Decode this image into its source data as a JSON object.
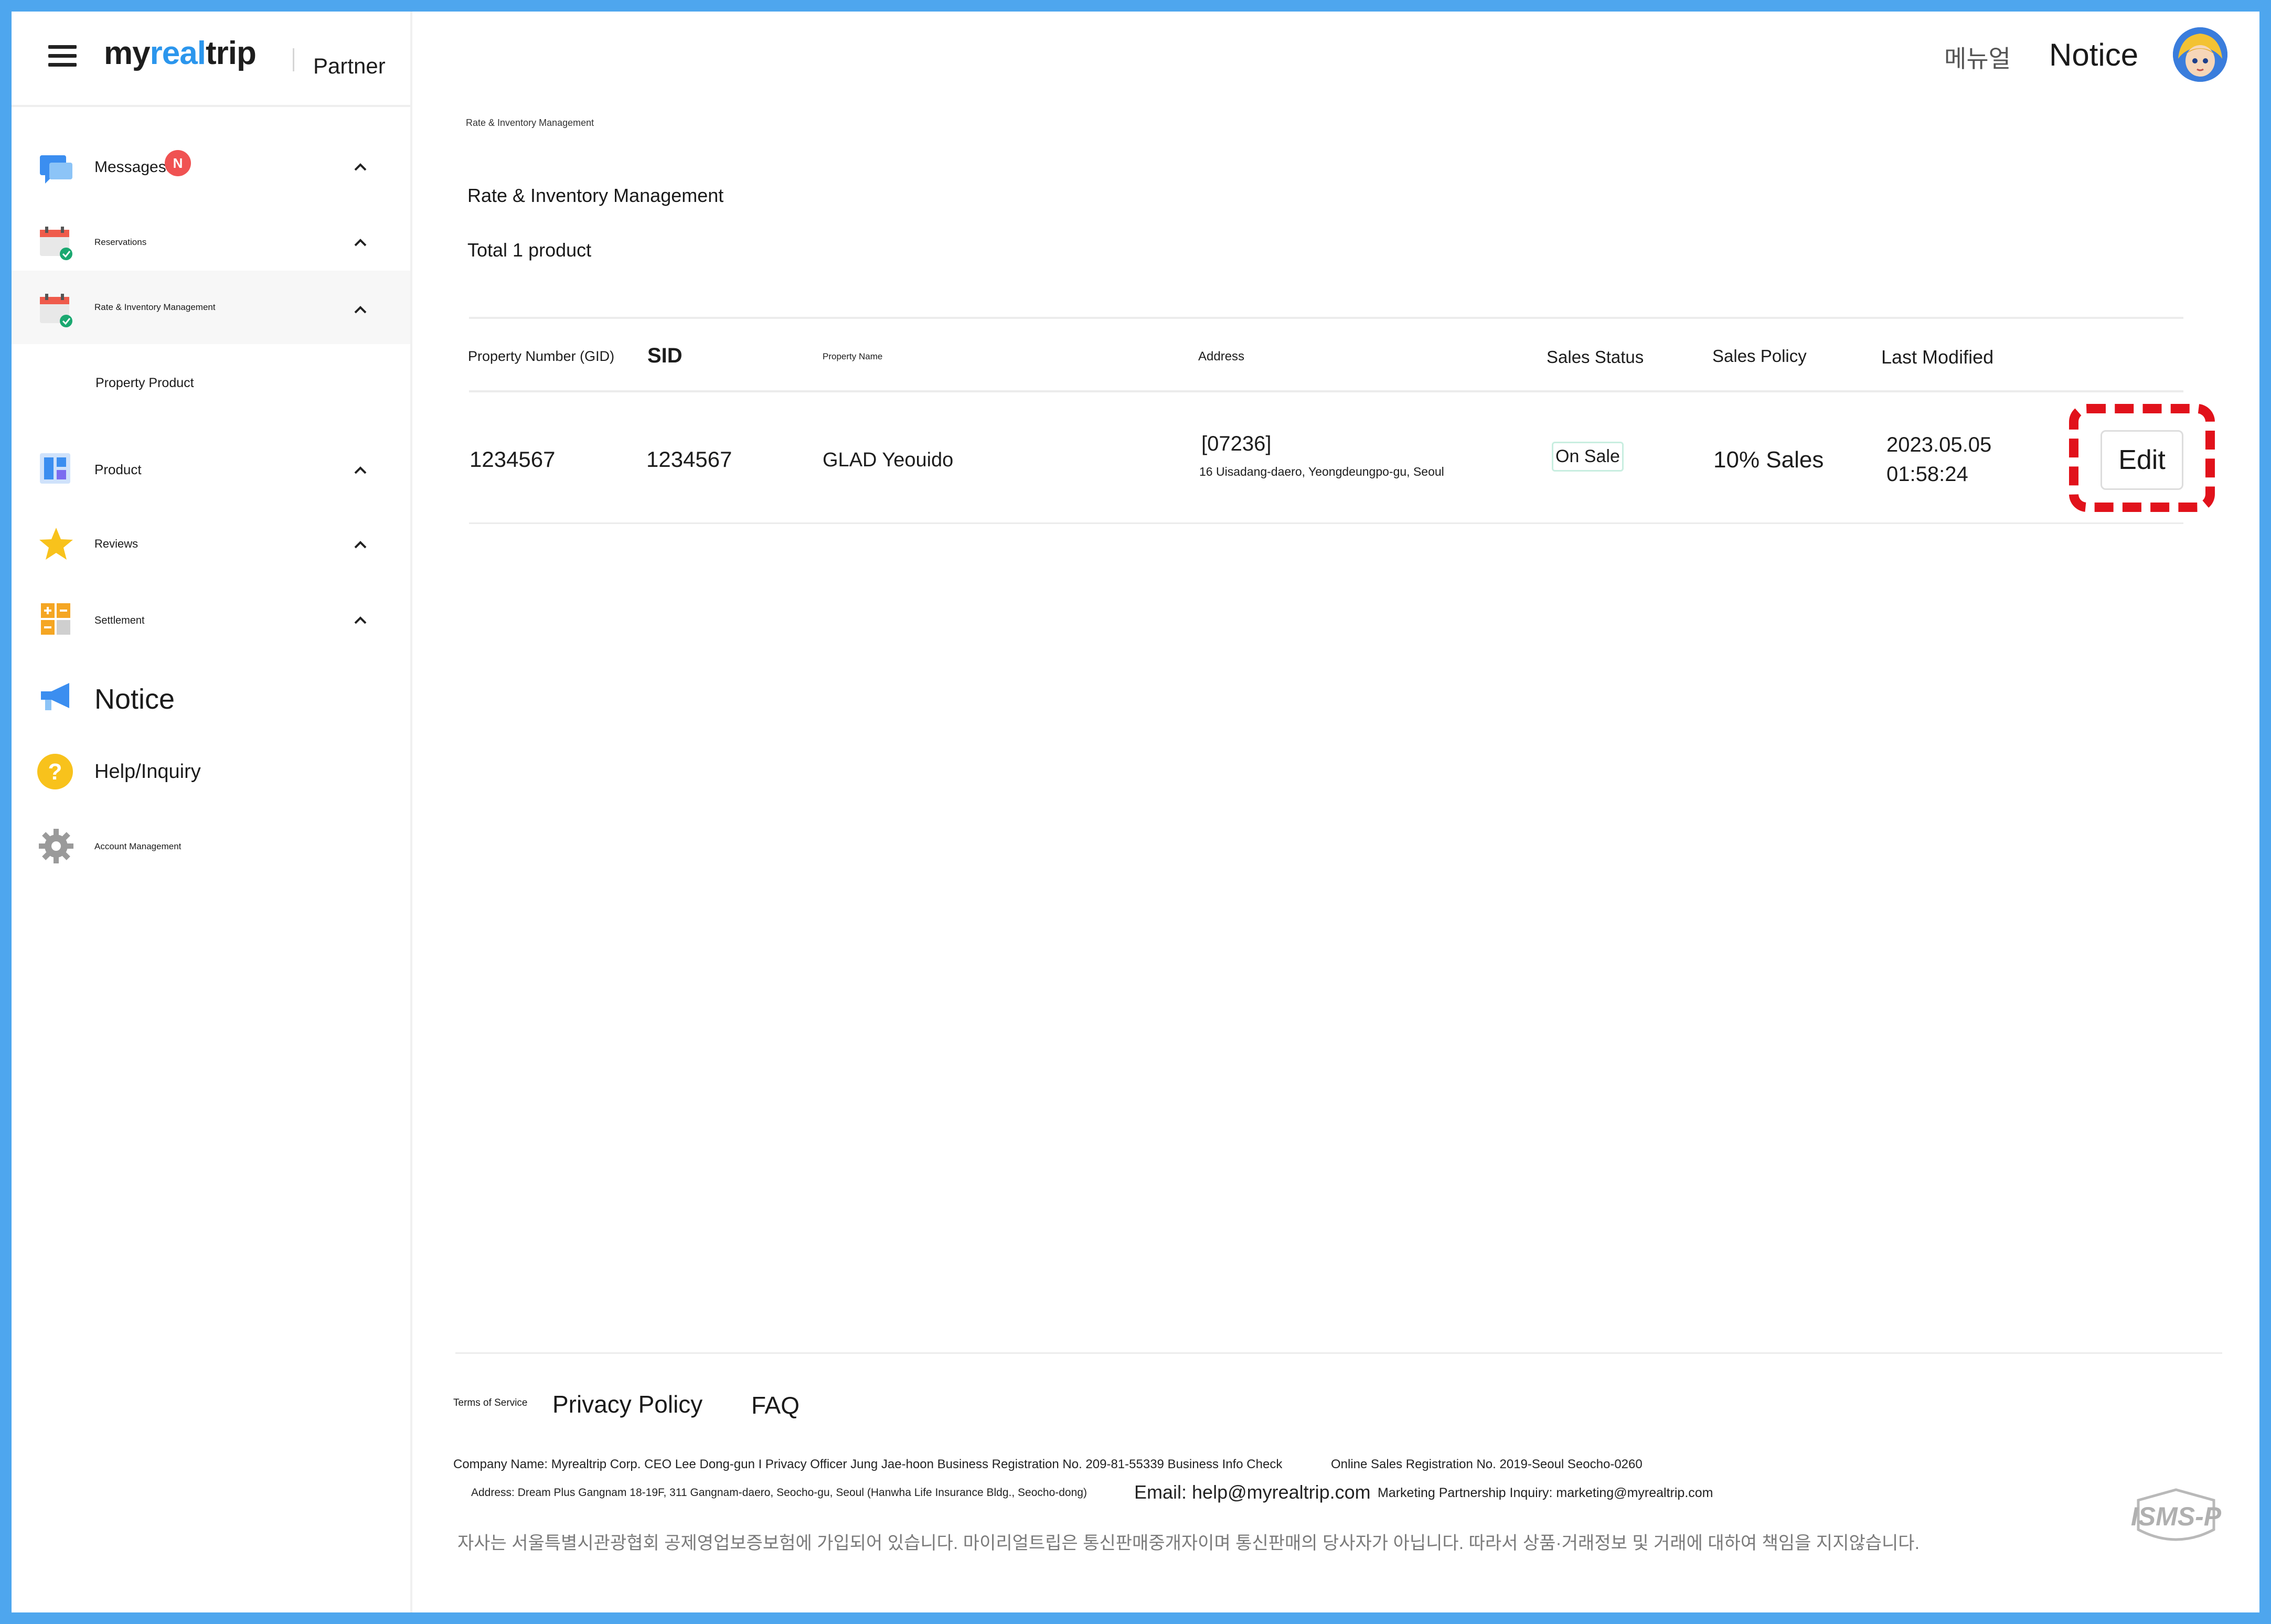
{
  "app": {
    "logo_prefix": "my",
    "logo_accent": "real",
    "logo_suffix": "trip",
    "partner_label": "Partner"
  },
  "topbar": {
    "manual": "메뉴얼",
    "notice": "Notice"
  },
  "sidebar": {
    "messages": {
      "label": "Messages",
      "badge": "N"
    },
    "reservations": {
      "label": "Reservations"
    },
    "rate_inventory": {
      "label": "Rate & Inventory Management"
    },
    "property_product": {
      "label": "Property Product"
    },
    "product": {
      "label": "Product"
    },
    "reviews": {
      "label": "Reviews"
    },
    "settlement": {
      "label": "Settlement"
    },
    "notice": {
      "label": "Notice"
    },
    "help": {
      "label": "Help/Inquiry"
    },
    "account": {
      "label": "Account Management"
    }
  },
  "main": {
    "breadcrumb": "Rate & Inventory Management",
    "title": "Rate & Inventory Management",
    "total": "Total 1 product"
  },
  "table": {
    "headers": {
      "gid": "Property Number (GID)",
      "sid": "SID",
      "name": "Property Name",
      "address": "Address",
      "status": "Sales Status",
      "policy": "Sales Policy",
      "modified": "Last Modified"
    },
    "rows": [
      {
        "gid": "1234567",
        "sid": "1234567",
        "name": "GLAD Yeouido",
        "postcode": "[07236]",
        "address": "16 Uisadang-daero, Yeongdeungpo-gu, Seoul",
        "status": "On Sale",
        "policy": "10% Sales",
        "modified_date": "2023.05.05",
        "modified_time": "01:58:24",
        "action": "Edit"
      }
    ]
  },
  "footer": {
    "terms": "Terms of Service",
    "privacy": "Privacy Policy",
    "faq": "FAQ",
    "company_info": "Company Name: Myrealtrip Corp.  CEO Lee Dong-gun I Privacy Officer Jung Jae-hoon Business Registration No. 209-81-55339 Business Info Check",
    "online_sales": "Online Sales Registration No. 2019-Seoul Seocho-0260",
    "address": "Address: Dream Plus Gangnam 18-19F, 311 Gangnam-daero, Seocho-gu, Seoul (Hanwha Life Insurance Bldg., Seocho-dong)",
    "email": "Email: help@myrealtrip.com",
    "marketing": "Marketing Partnership Inquiry: marketing@myrealtrip.com",
    "disclaimer": "자사는 서울특별시관광협회 공제영업보증보험에 가입되어 있습니다. 마이리얼트립은 통신판매중개자이며 통신판매의 당사자가 아닙니다. 따라서 상품·거래정보 및 거래에 대하여 책임을 지지않습니다.",
    "cert_logo": "ISMS-P"
  },
  "colors": {
    "accent": "#4ea6ee",
    "highlight": "#e1121b",
    "badge": "#f05252",
    "on_sale_border": "#c8eee0"
  },
  "icons": [
    "menu-icon",
    "chat-icon",
    "calendar-check-icon",
    "dashboard-icon",
    "star-icon",
    "calculator-icon",
    "megaphone-icon",
    "question-icon",
    "gear-icon",
    "chevron-up-icon",
    "avatar-image"
  ]
}
